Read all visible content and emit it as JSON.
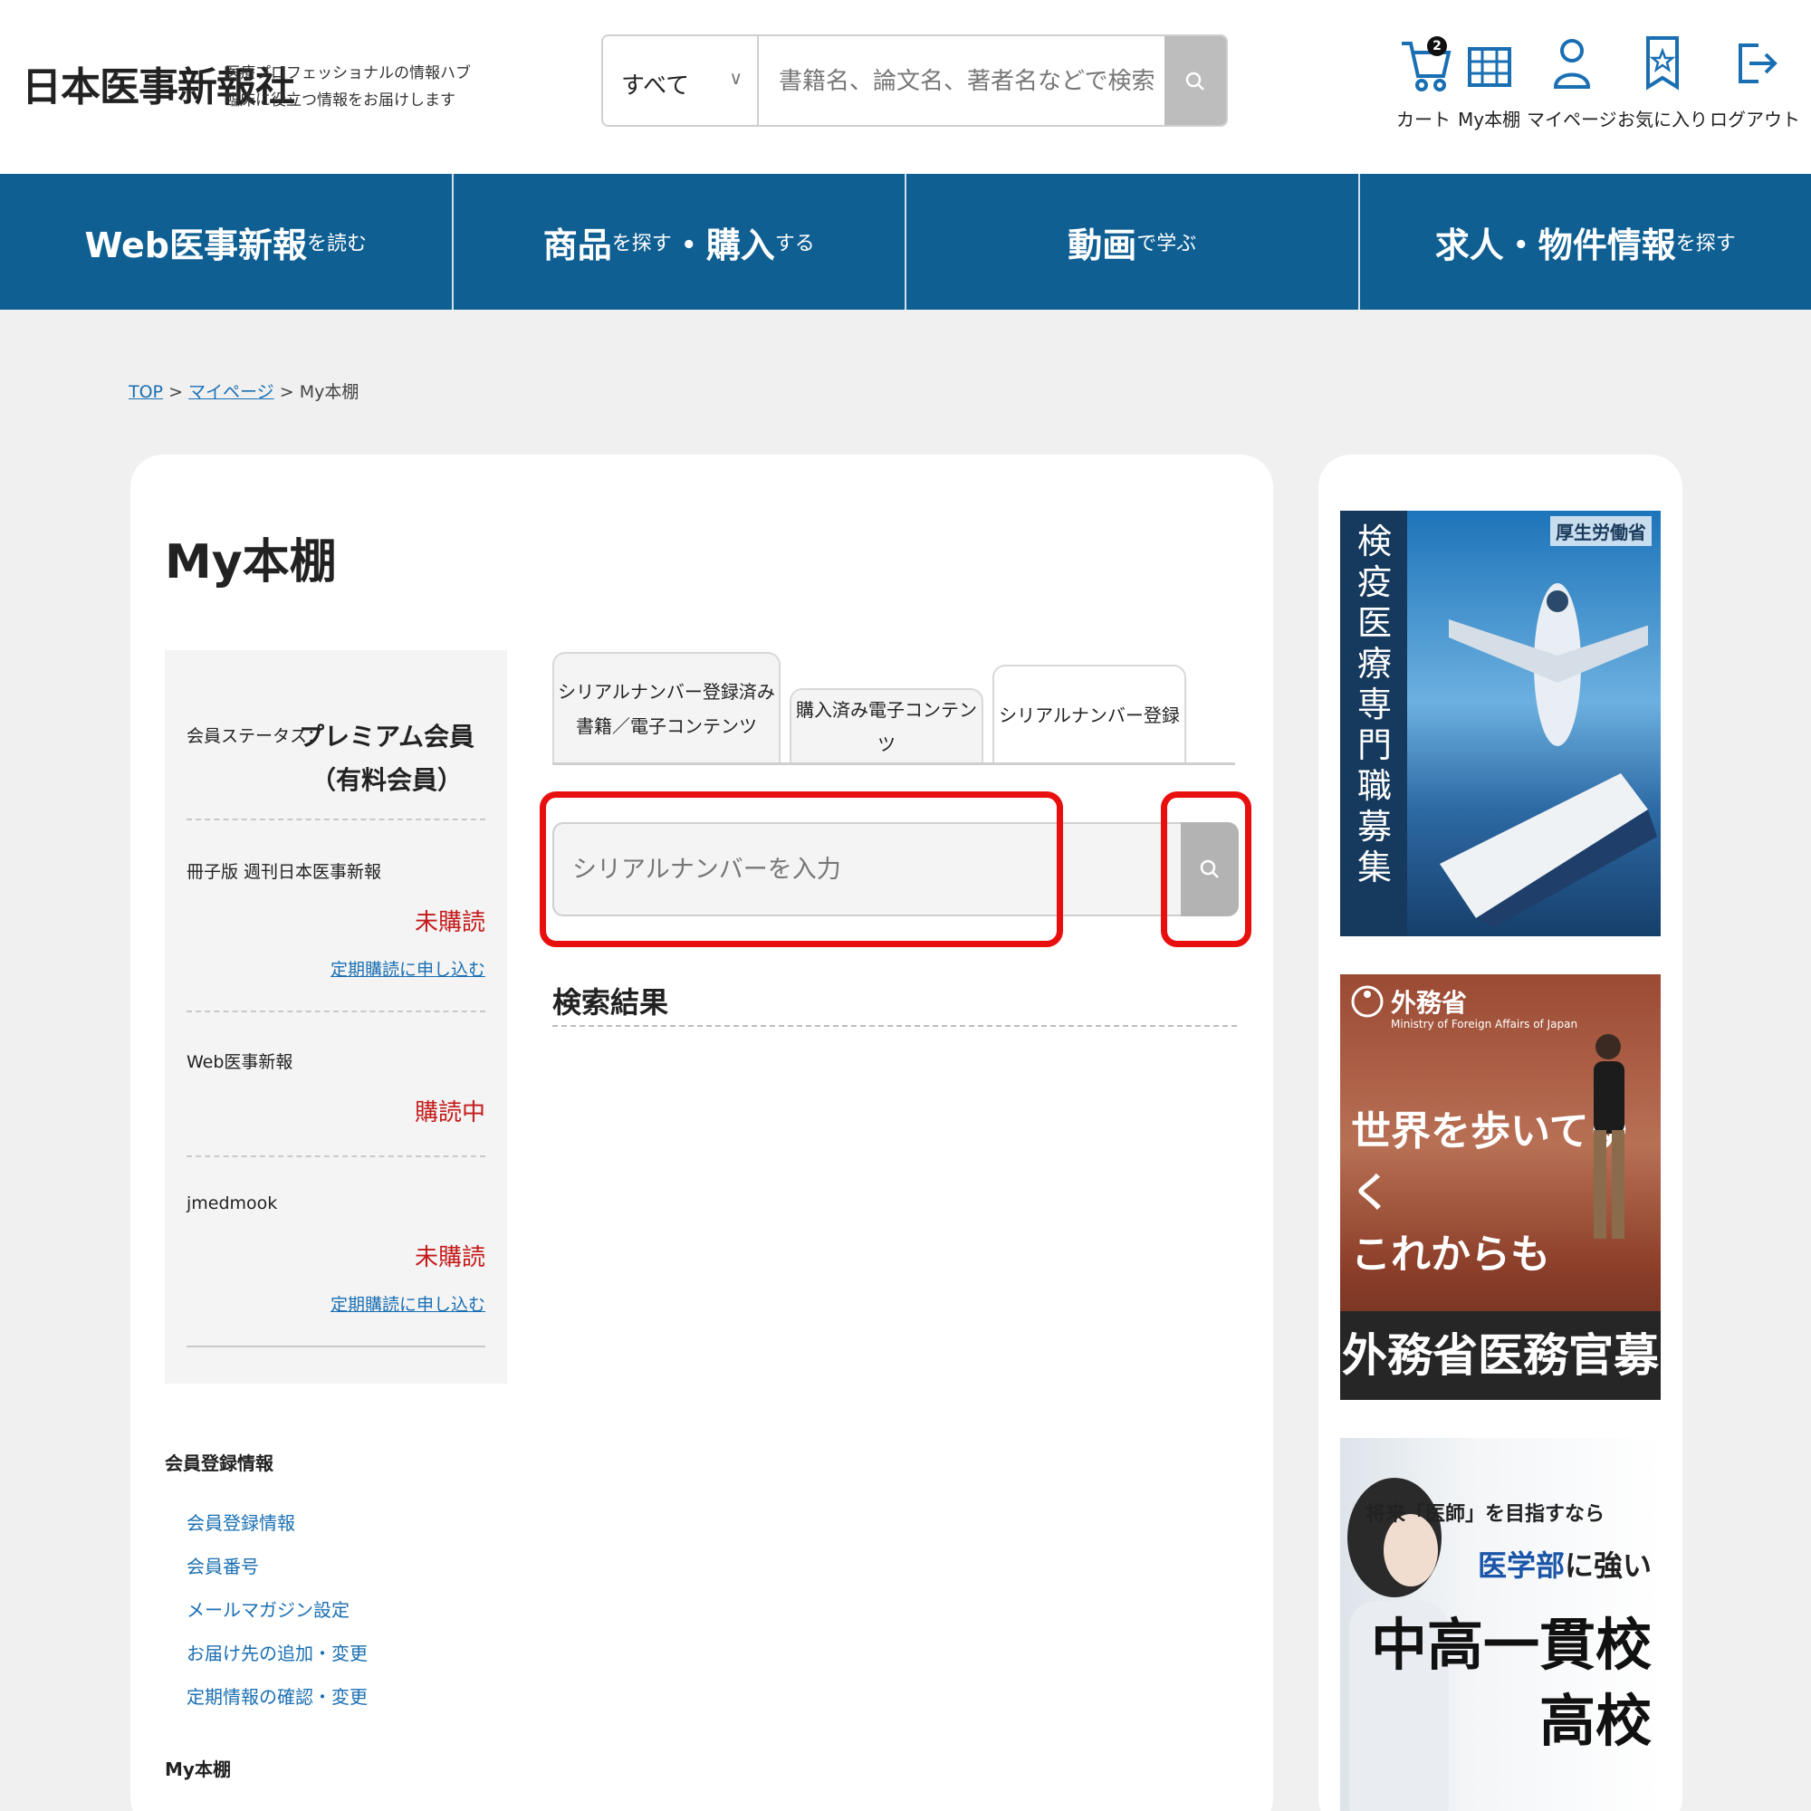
{
  "header": {
    "logo": "日本医事新報社",
    "tagline_line1": "医療プロフェッショナルの情報ハブ",
    "tagline_line2": "臨床に役立つ情報をお届けします",
    "search": {
      "category": "すべて",
      "placeholder": "書籍名、論文名、著者名などで検索"
    },
    "utility": {
      "cart_label": "カート",
      "cart_badge": "2",
      "bookshelf_label": "My本棚",
      "mypage_label": "マイページ",
      "favorites_label": "お気に入り",
      "logout_label": "ログアウト"
    }
  },
  "nav": {
    "item1_big": "Web医事新報",
    "item1_small": "を読む",
    "item2_big1": "商品",
    "item2_small1": "を探す",
    "item2_big2": "・購入",
    "item2_small2": "する",
    "item3_big": "動画",
    "item3_small": "で学ぶ",
    "item4_big": "求人・物件情報",
    "item4_small": "を探す"
  },
  "breadcrumb": {
    "top": "TOP",
    "sep": ">",
    "mypage": "マイページ",
    "current": "My本棚"
  },
  "main": {
    "title": "My本棚",
    "status": {
      "member_label": "会員ステータス：",
      "member_value_line1": "プレミアム会員",
      "member_value_line2": "（有料会員）",
      "rows": [
        {
          "label": "冊子版 週刊日本医事新報",
          "value": "未購読",
          "link": "定期購読に申し込む"
        },
        {
          "label": "Web医事新報",
          "value": "購読中"
        },
        {
          "label": "jmedmook",
          "value": "未購読",
          "link": "定期購読に申し込む"
        }
      ]
    },
    "menu": {
      "heading1": "会員登録情報",
      "links": [
        "会員登録情報",
        "会員番号",
        "メールマガジン設定",
        "お届け先の追加・変更",
        "定期情報の確認・変更"
      ],
      "heading2": "My本棚"
    },
    "tabs": {
      "tab1_line1": "シリアルナンバー登録済み",
      "tab1_line2": "書籍／電子コンテンツ",
      "tab2": "購入済み電子コンテンツ",
      "tab3": "シリアルナンバー登録"
    },
    "serial_placeholder": "シリアルナンバーを入力",
    "results_title": "検索結果"
  },
  "side": {
    "banner1": {
      "vertical_text": "検疫医療専門職募集",
      "ministry": "厚生労働省"
    },
    "banner2": {
      "ministry": "外務省",
      "ministry_en": "Ministry of Foreign Affairs of Japan",
      "copy_line1": "世界を歩いてゆく",
      "copy_line2": "これからも",
      "bottom": "外務省医務官募集"
    },
    "banner3": {
      "line1": "将来「医師」を目指すなら",
      "line2_blue": "医学部",
      "line2_rest": "に強い",
      "line3": "中高一貫校",
      "line4": "高校"
    }
  },
  "colors": {
    "nav_bg": "#0f5f93",
    "link": "#1a6fb3",
    "status_red": "#c51a1a",
    "highlight_red": "#e80f0f"
  }
}
